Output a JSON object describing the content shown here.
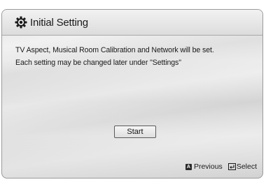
{
  "dialog": {
    "title": "Initial Setting",
    "title_icon": "gear-icon",
    "message_line1": "TV Aspect, Musical Room Calibration and Network will be set.",
    "message_line2": "Each setting may be changed later under \"Settings\"",
    "start_label": "Start"
  },
  "footer": {
    "previous_key": "A",
    "previous_label": "Previous",
    "select_icon": "enter-icon",
    "select_label": "Select"
  }
}
